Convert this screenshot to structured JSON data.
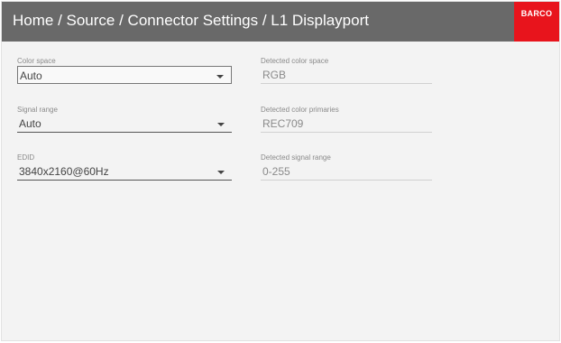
{
  "header": {
    "breadcrumb": "Home / Source / Connector Settings / L1 Displayport",
    "logo_text": "BARCO",
    "bg_color": "#696969",
    "logo_color": "#e8141c"
  },
  "settings": {
    "color_space": {
      "label": "Color space",
      "value": "Auto"
    },
    "signal_range": {
      "label": "Signal range",
      "value": "Auto"
    },
    "edid": {
      "label": "EDID",
      "value": "3840x2160@60Hz"
    }
  },
  "detected": {
    "color_space": {
      "label": "Detected color space",
      "value": "RGB"
    },
    "color_primaries": {
      "label": "Detected color primaries",
      "value": "REC709"
    },
    "signal_range": {
      "label": "Detected signal range",
      "value": "0-255"
    }
  },
  "icons": {
    "dropdown": "chevron-down-icon"
  }
}
